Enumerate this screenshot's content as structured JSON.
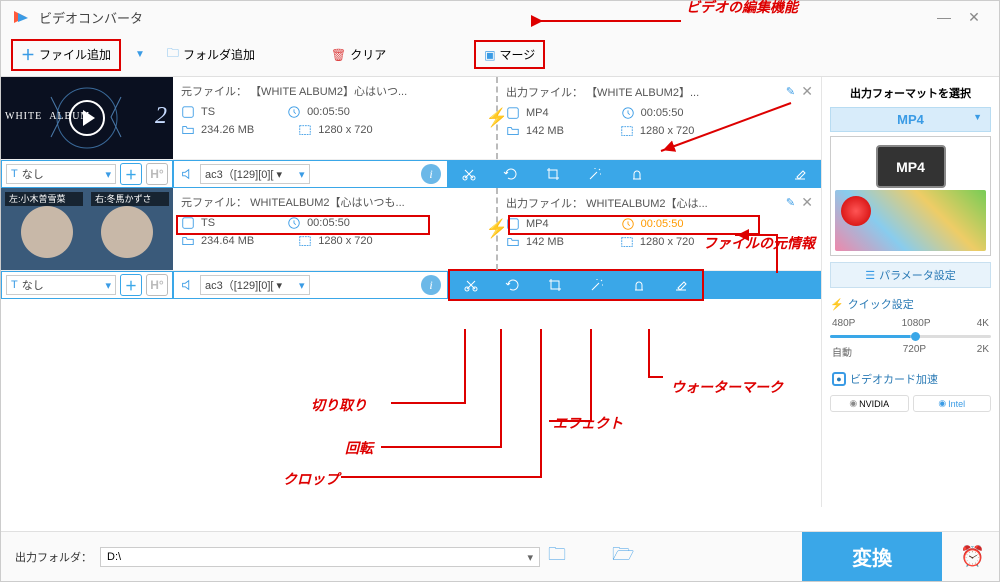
{
  "app": {
    "title": "ビデオコンバータ"
  },
  "toolbar": {
    "add_file": "ファイル追加",
    "add_folder": "フォルダ追加",
    "clear": "クリア",
    "merge": "マージ"
  },
  "items": [
    {
      "source_label": "元ファイル：",
      "source_name": "【WHITE ALBUM2】心はいつ...",
      "format": "TS",
      "duration": "00:05:50",
      "size": "234.26 MB",
      "resolution": "1280 x 720",
      "out_label": "出力ファイル：",
      "out_name": "【WHITE ALBUM2】...",
      "out_format": "MP4",
      "out_duration": "00:05:50",
      "out_size": "142 MB",
      "out_resolution": "1280 x 720",
      "subtitle_none": "なし",
      "audio_track": "ac3（[129][0][ ▾"
    },
    {
      "source_label": "元ファイル：",
      "source_name": "WHITEALBUM2【心はいつも...",
      "format": "TS",
      "duration": "00:05:50",
      "size": "234.64 MB",
      "resolution": "1280 x 720",
      "out_label": "出力ファイル：",
      "out_name": "WHITEALBUM2【心は...",
      "out_format": "MP4",
      "out_duration": "00:05:50",
      "out_size": "142 MB",
      "out_resolution": "1280 x 720",
      "subtitle_none": "なし",
      "audio_track": "ac3（[129][0][ ▾"
    }
  ],
  "side": {
    "title": "出力フォーマットを選択",
    "format": "MP4",
    "mp4_label": "MP4",
    "param_btn": "パラメータ設定",
    "quick_title": "クイック設定",
    "presets_top": [
      "480P",
      "1080P",
      "4K"
    ],
    "presets_bottom": [
      "自動",
      "720P",
      "2K"
    ],
    "gpu_accel": "ビデオカード加速",
    "nvidia": "NVIDIA",
    "intel": "Intel"
  },
  "bottom": {
    "label": "出力フォルダ：",
    "path": "D:\\",
    "convert": "変換"
  },
  "annotations": {
    "edit_feature": "ビデオの編集機能",
    "file_info": "ファイルの元情報",
    "watermark": "ウォーターマーク",
    "effect": "エフェクト",
    "crop": "クロップ",
    "rotate": "回転",
    "trim": "切り取り"
  }
}
